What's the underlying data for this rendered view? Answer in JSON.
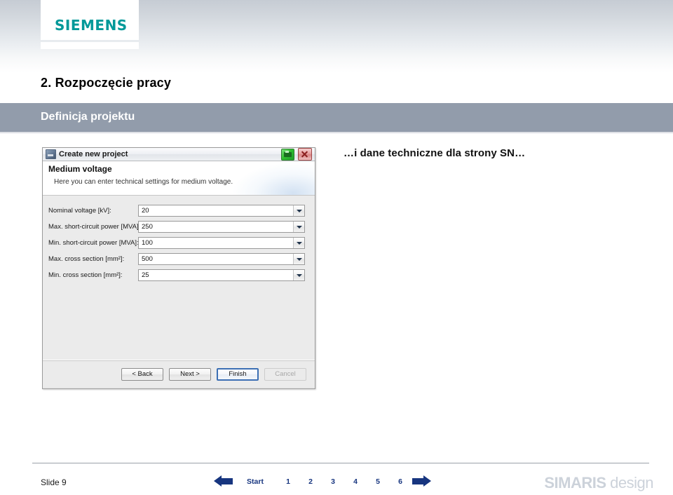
{
  "slide": {
    "brand_logo": "SIEMENS",
    "title": "2. Rozpoczęcie pracy",
    "subtitle": "Definicja projektu",
    "caption": "…i dane techniczne dla strony SN…"
  },
  "dialog": {
    "title": "Create new project",
    "app_icon": "project-icon",
    "help_icon": "help-printer-icon",
    "close_icon": "close-icon",
    "header_title": "Medium voltage",
    "header_subtitle": "Here you can enter technical settings for medium voltage.",
    "fields": [
      {
        "label": "Nominal voltage [kV]:",
        "value": "20"
      },
      {
        "label": "Max. short-circuit power [MVA]:",
        "value": "250"
      },
      {
        "label": "Min. short-circuit power [MVA]:",
        "value": "100"
      },
      {
        "label": "Max. cross section [mm²]:",
        "value": "500"
      },
      {
        "label": "Min. cross section [mm²]:",
        "value": "25"
      }
    ],
    "buttons": {
      "back": "< Back",
      "next": "Next >",
      "finish": "Finish",
      "cancel": "Cancel"
    }
  },
  "footer": {
    "slide_label": "Slide 9",
    "prev_icon": "arrow-left-icon",
    "next_icon": "arrow-right-icon",
    "start_label": "Start",
    "pages": [
      "1",
      "2",
      "3",
      "4",
      "5",
      "6"
    ],
    "brand_bold": "SIMARIS",
    "brand_light": " design"
  },
  "colors": {
    "siemens_teal": "#009999",
    "subtitle_bar": "#929cab",
    "nav_blue": "#17357f",
    "brand_gray": "#ccd2da"
  }
}
